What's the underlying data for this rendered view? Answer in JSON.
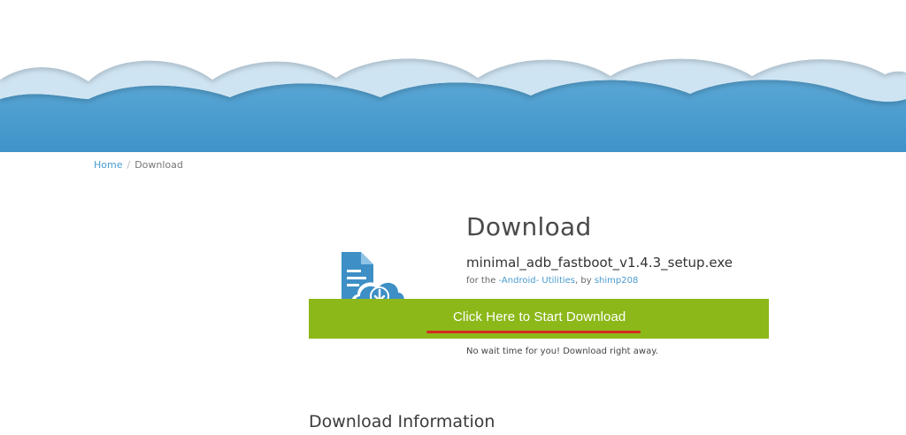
{
  "breadcrumb": {
    "home": "Home",
    "separator": "/",
    "current": "Download"
  },
  "download": {
    "title": "Download",
    "filename": "minimal_adb_fastboot_v1.4.3_setup.exe",
    "for_prefix": "for the",
    "category": "-Android- Utilities",
    "by_prefix": ", by",
    "author": "shimp208",
    "button_label": "Click Here to Start Download",
    "note": "No wait time for you! Download right away."
  },
  "info": {
    "title": "Download Information"
  },
  "colors": {
    "download_bar": "#8cb819",
    "link": "#4a9bd0",
    "sky": "#4a9bd0",
    "annotation": "#d42b1f"
  },
  "icons": {
    "file": "file-download-cloud-icon"
  }
}
